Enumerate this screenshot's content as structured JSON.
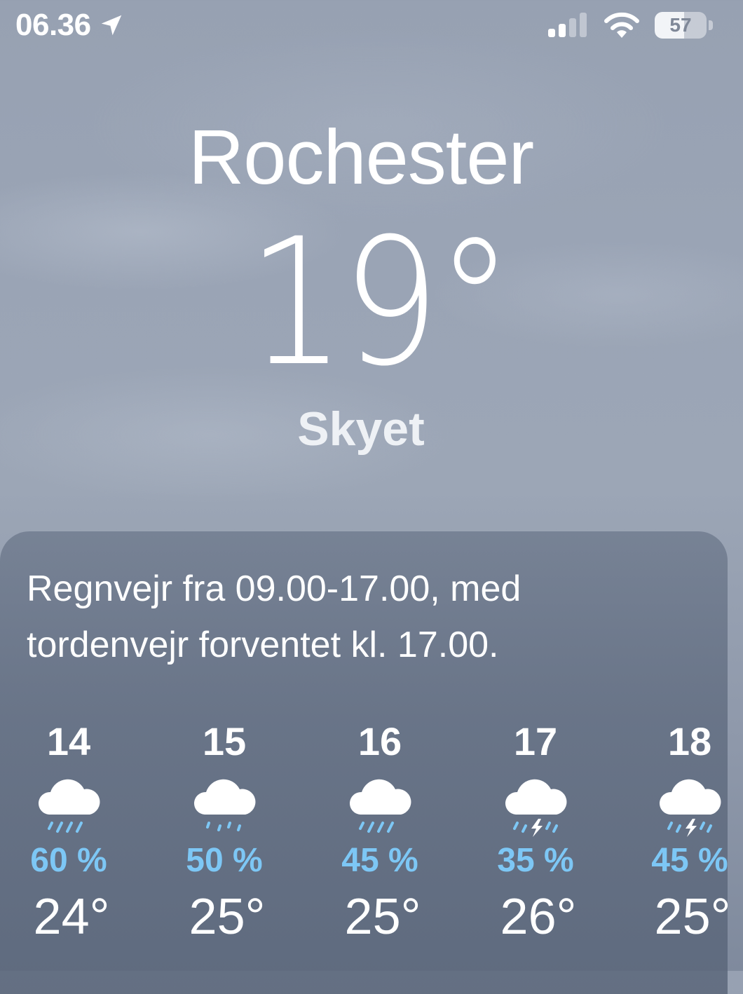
{
  "status_bar": {
    "time": "06.36",
    "battery_level": "57",
    "battery_fraction": 0.57,
    "signal_bars_active": 2,
    "signal_bars_total": 4
  },
  "header": {
    "city": "Rochester",
    "temperature": "19°",
    "condition": "Skyet"
  },
  "forecast": {
    "summary_line1": "Regnvejr fra 09.00-17.00, med",
    "summary_line2": "tordenvejr forventet kl. 17.00.",
    "hours": [
      {
        "hour": "14",
        "icon": "cloud-rain-icon",
        "precip": "60 %",
        "temp": "24°"
      },
      {
        "hour": "15",
        "icon": "cloud-drizzle-icon",
        "precip": "50 %",
        "temp": "25°"
      },
      {
        "hour": "16",
        "icon": "cloud-rain-icon",
        "precip": "45 %",
        "temp": "25°"
      },
      {
        "hour": "17",
        "icon": "cloud-bolt-rain-icon",
        "precip": "35 %",
        "temp": "26°"
      },
      {
        "hour": "18",
        "icon": "cloud-bolt-rain-icon",
        "precip": "45 %",
        "temp": "25°"
      }
    ]
  },
  "colors": {
    "precip_text": "#7dc7f5",
    "background": "#9aa4b5",
    "card": "#5c687c"
  }
}
